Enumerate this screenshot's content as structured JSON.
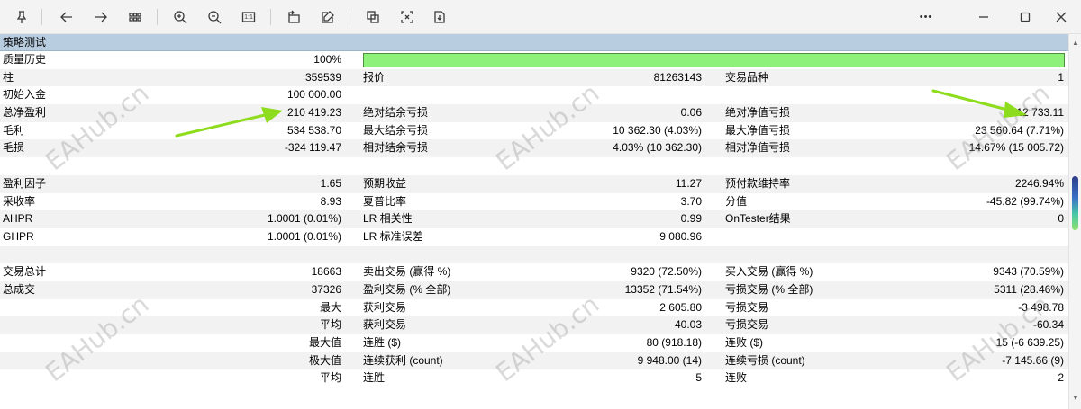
{
  "toolbar": {
    "icons": [
      "pin-icon",
      "back-icon",
      "forward-icon",
      "grid-icon",
      "zoom-in-icon",
      "zoom-out-icon",
      "fit-icon",
      "rotate-icon",
      "edit-icon",
      "crop-icon",
      "screenshot-icon",
      "save-icon",
      "more-icon",
      "minimize-icon",
      "maximize-icon",
      "close-icon"
    ],
    "fit_label": "1:1",
    "more_label": "•••"
  },
  "panel": {
    "title": "策略测试"
  },
  "report": {
    "quality": {
      "label": "质量历史",
      "value": "100%",
      "fill_percent": 100,
      "bar_color": "#8ef27a"
    },
    "rows": [
      {
        "c1": "柱",
        "v1": "359539",
        "c2": "报价",
        "v2": "81263143",
        "c3": "交易品种",
        "v3": "1"
      },
      {
        "c1": "初始入金",
        "v1": "100 000.00",
        "c2": "",
        "v2": "",
        "c3": "",
        "v3": ""
      },
      {
        "c1": "总净盈利",
        "v1": "210 419.23",
        "c2": "绝对结余亏损",
        "v2": "0.06",
        "c3": "绝对净值亏损",
        "v3": "12 733.11"
      },
      {
        "c1": "毛利",
        "v1": "534 538.70",
        "c2": "最大结余亏损",
        "v2": "10 362.30 (4.03%)",
        "c3": "最大净值亏损",
        "v3": "23 560.64 (7.71%)"
      },
      {
        "c1": "毛损",
        "v1": "-324 119.47",
        "c2": "相对结余亏损",
        "v2": "4.03% (10 362.30)",
        "c3": "相对净值亏损",
        "v3": "14.67% (15 005.72)"
      },
      {
        "c1": "",
        "v1": "",
        "c2": "",
        "v2": "",
        "c3": "",
        "v3": ""
      },
      {
        "c1": "盈利因子",
        "v1": "1.65",
        "c2": "预期收益",
        "v2": "11.27",
        "c3": "预付款维持率",
        "v3": "2246.94%"
      },
      {
        "c1": "采收率",
        "v1": "8.93",
        "c2": "夏普比率",
        "v2": "3.70",
        "c3": "分值",
        "v3": "-45.82 (99.74%)"
      },
      {
        "c1": "AHPR",
        "v1": "1.0001 (0.01%)",
        "c2": "LR 相关性",
        "v2": "0.99",
        "c3": "OnTester结果",
        "v3": "0"
      },
      {
        "c1": "GHPR",
        "v1": "1.0001 (0.01%)",
        "c2": "LR 标准误差",
        "v2": "9 080.96",
        "c3": "",
        "v3": ""
      },
      {
        "c1": "",
        "v1": "",
        "c2": "",
        "v2": "",
        "c3": "",
        "v3": ""
      },
      {
        "c1": "交易总计",
        "v1": "18663",
        "c2": "卖出交易 (赢得 %)",
        "v2": "9320 (72.50%)",
        "c3": "买入交易 (赢得 %)",
        "v3": "9343 (70.59%)"
      },
      {
        "c1": "总成交",
        "v1": "37326",
        "c2": "盈利交易 (% 全部)",
        "v2": "13352 (71.54%)",
        "c3": "亏损交易 (% 全部)",
        "v3": "5311 (28.46%)"
      },
      {
        "c1": "",
        "v1": "最大",
        "c2": "获利交易",
        "v2": "2 605.80",
        "c3": "亏损交易",
        "v3": "-3 498.78"
      },
      {
        "c1": "",
        "v1": "平均",
        "c2": "获利交易",
        "v2": "40.03",
        "c3": "亏损交易",
        "v3": "-60.34"
      },
      {
        "c1": "",
        "v1": "最大值",
        "c2": "连胜 ($)",
        "v2": "80 (918.18)",
        "c3": "连败 ($)",
        "v3": "15 (-6 639.25)"
      },
      {
        "c1": "",
        "v1": "极大值",
        "c2": "连续获利 (count)",
        "v2": "9 948.00 (14)",
        "c3": "连续亏损 (count)",
        "v3": "-7 145.66 (9)"
      },
      {
        "c1": "",
        "v1": "平均",
        "c2": "连胜",
        "v2": "5",
        "c3": "连败",
        "v3": "2"
      }
    ]
  },
  "watermark": {
    "text": "EAHub.cn"
  },
  "colors": {
    "header": "#b9cde0",
    "arrow": "#8edc1e",
    "alt_row": "#f2f2f2"
  }
}
